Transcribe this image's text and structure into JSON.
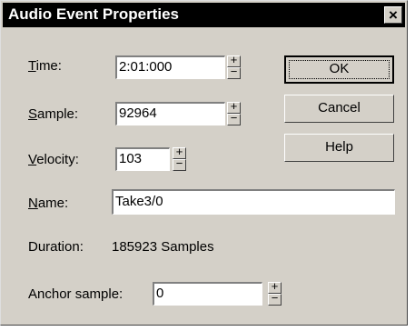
{
  "window": {
    "title": "Audio Event Properties",
    "close_glyph": "×"
  },
  "fields": {
    "time": {
      "label_mnemonic": "T",
      "label_rest": "ime:",
      "value": "2:01:000"
    },
    "sample": {
      "label_mnemonic": "S",
      "label_rest": "ample:",
      "value": "92964"
    },
    "velocity": {
      "label_mnemonic": "V",
      "label_rest": "elocity:",
      "value": "103"
    },
    "name": {
      "label_mnemonic": "N",
      "label_rest": "ame:",
      "value": "Take3/0"
    },
    "anchor": {
      "label": "Anchor sample:",
      "value": "0"
    }
  },
  "duration": {
    "label": "Duration:",
    "value": "185923 Samples"
  },
  "buttons": {
    "ok": "OK",
    "cancel": "Cancel",
    "help": "Help"
  },
  "spinner": {
    "up_glyph": "+",
    "down_glyph": "−"
  },
  "icons": {
    "close": "close-icon",
    "spin_up": "plus-icon",
    "spin_down": "minus-icon"
  },
  "colors": {
    "face": "#d4d0c8",
    "titlebar": "#000000",
    "title_text": "#ffffff"
  }
}
